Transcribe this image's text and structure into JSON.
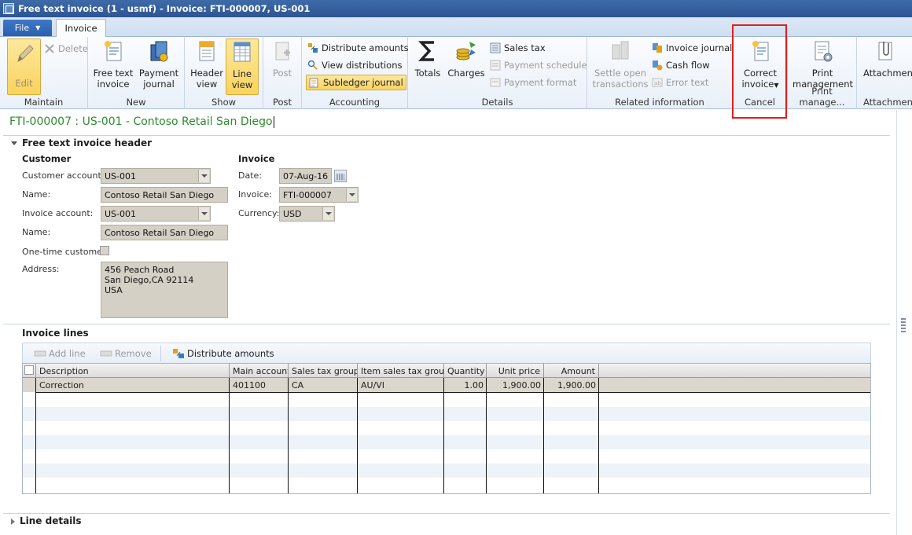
{
  "window": {
    "title": "Free text invoice (1 - usmf) - Invoice: FTI-000007, US-001"
  },
  "tabs": {
    "file": "File",
    "invoice": "Invoice"
  },
  "ribbon": {
    "maintain": {
      "label": "Maintain",
      "edit": "Edit",
      "delete": "Delete"
    },
    "new": {
      "label": "New",
      "free_text_invoice": [
        "Free text",
        "invoice"
      ],
      "payment_journal": [
        "Payment",
        "journal"
      ]
    },
    "show": {
      "label": "Show",
      "header_view": [
        "Header",
        "view"
      ],
      "line_view": [
        "Line",
        "view"
      ]
    },
    "post": {
      "label": "Post",
      "post": "Post"
    },
    "accounting": {
      "label": "Accounting",
      "distribute_amounts": "Distribute amounts",
      "view_distributions": "View distributions",
      "subledger_journal": "Subledger journal"
    },
    "details": {
      "label": "Details",
      "totals": "Totals",
      "charges": "Charges",
      "sales_tax": "Sales tax",
      "payment_schedule": "Payment schedule",
      "payment_format": "Payment format"
    },
    "related": {
      "label": "Related information",
      "settle_open": [
        "Settle open",
        "transactions"
      ],
      "invoice_journal": "Invoice journal",
      "cash_flow": "Cash flow",
      "error_text": "Error text"
    },
    "cancel": {
      "label": "Cancel",
      "correct_invoice": [
        "Correct",
        "invoice"
      ]
    },
    "print_mgmt": {
      "label": "Print manage...",
      "print_management": [
        "Print",
        "management"
      ]
    },
    "attachments": {
      "label": "Attachments",
      "attachments": "Attachments"
    }
  },
  "caption": "FTI-000007 : US-001 - Contoso Retail San Diego",
  "header_section": {
    "title": "Free text invoice header",
    "customer": {
      "heading": "Customer",
      "customer_account_label": "Customer account:",
      "customer_account": "US-001",
      "name_label": "Name:",
      "name": "Contoso Retail San Diego",
      "invoice_account_label": "Invoice account:",
      "invoice_account": "US-001",
      "name2_label": "Name:",
      "name2": "Contoso Retail San Diego",
      "one_time_label": "One-time customer:",
      "address_label": "Address:",
      "address": "456 Peach Road\nSan Diego,CA 92114\nUSA"
    },
    "invoice": {
      "heading": "Invoice",
      "date_label": "Date:",
      "date": "07-Aug-16",
      "invoice_label": "Invoice:",
      "invoice": "FTI-000007",
      "currency_label": "Currency:",
      "currency": "USD"
    }
  },
  "lines": {
    "title": "Invoice lines",
    "toolbar": {
      "add_line": "Add line",
      "remove": "Remove",
      "distribute_amounts": "Distribute amounts"
    },
    "columns": [
      "Description",
      "Main account",
      "Sales tax group",
      "Item sales tax group",
      "Quantity",
      "Unit price",
      "Amount"
    ],
    "rows": [
      {
        "description": "Correction",
        "main_account": "401100",
        "sales_tax_group": "CA",
        "item_sales_tax_group": "AU/VI",
        "quantity": "1.00",
        "unit_price": "1,900.00",
        "amount": "1,900.00"
      }
    ]
  },
  "line_details": {
    "title": "Line details"
  },
  "colors": {
    "caption": "#2e8b30",
    "highlight_box": "#e31d1d",
    "active_button": "#f9d35f"
  }
}
